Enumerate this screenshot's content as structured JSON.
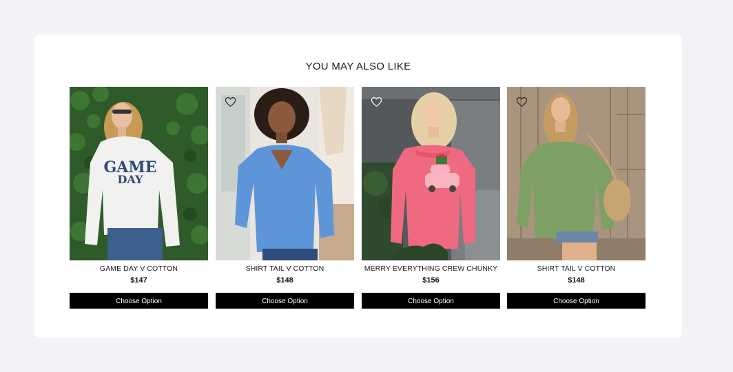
{
  "section": {
    "title": "YOU MAY ALSO LIKE"
  },
  "products": [
    {
      "name": "GAME DAY V COTTON",
      "price": "$147",
      "cta": "Choose Option",
      "sweater_text_line1": "GAME",
      "sweater_text_line2": "DAY",
      "sweater_color": "#f1f1ef",
      "background": "#2f5a2a"
    },
    {
      "name": "SHIRT TAIL V COTTON",
      "price": "$148",
      "cta": "Choose Option",
      "sweater_color": "#5e95d9",
      "background": "#e9e5df"
    },
    {
      "name": "MERRY EVERYTHING CREW CHUNKY",
      "price": "$156",
      "cta": "Choose Option",
      "sweater_color": "#ef6a80",
      "background": "#55585a"
    },
    {
      "name": "SHIRT TAIL V COTTON",
      "price": "$148",
      "cta": "Choose Option",
      "sweater_color": "#7ea064",
      "background": "#a9957f"
    }
  ]
}
